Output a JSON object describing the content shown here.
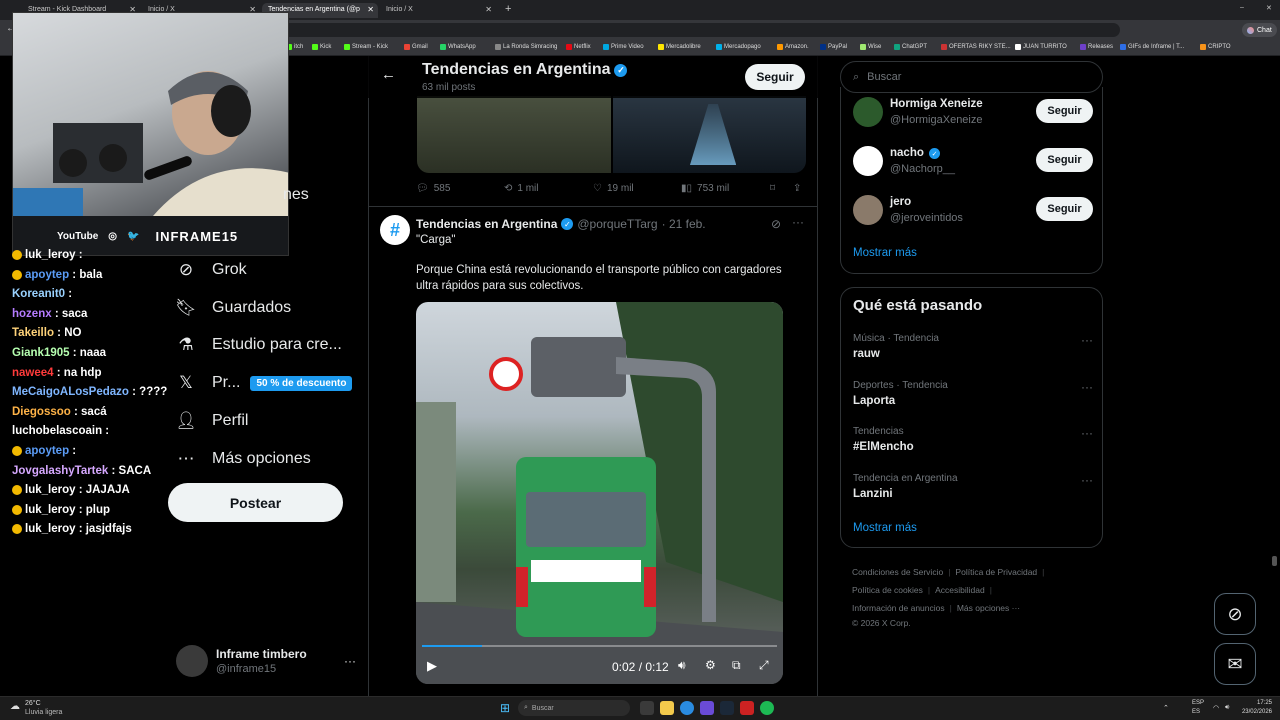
{
  "browser": {
    "tabs": [
      {
        "label": "Stream - Kick Dashboard"
      },
      {
        "label": "Inicio / X"
      },
      {
        "label": "Tendencias en Argentina (@p"
      },
      {
        "label": "Inicio / X"
      }
    ],
    "bookmarks": [
      "itch",
      "Kick",
      "Stream - Kick",
      "Gmail",
      "WhatsApp",
      "La Ronda Simracing",
      "Netflix",
      "Prime Video",
      "Mercadolibre",
      "Mercadopago",
      "Amazon.",
      "PayPal",
      "Wise",
      "ChatGPT",
      "OFERTAS RIKY STE...",
      "JUAN TURRITO",
      "Releases",
      "GIFs de Inframe | T...",
      "CRIPTO"
    ],
    "chat_label": "Chat"
  },
  "overlay": {
    "youtube": "YouTube",
    "handle": "INFRAME15",
    "chat": [
      {
        "user": "luk_leroy",
        "msg": "",
        "color": "#ffffff",
        "badge": true
      },
      {
        "user": "apoytep",
        "msg": "bala",
        "color": "#5b9cf6",
        "badge": true
      },
      {
        "user": "Koreanit0",
        "msg": "",
        "color": "#9ad2ff",
        "badge": false
      },
      {
        "user": "hozenx",
        "msg": "saca",
        "color": "#b57cff",
        "badge": false
      },
      {
        "user": "Takeillo",
        "msg": "NO",
        "color": "#ffd37a",
        "badge": false
      },
      {
        "user": "Giank1905",
        "msg": "naaa",
        "color": "#b6ffb0",
        "badge": false
      },
      {
        "user": "nawee4",
        "msg": "na hdp",
        "color": "#ff3b3b",
        "badge": false
      },
      {
        "user": "MeCaigoALosPedazo",
        "msg": "????",
        "color": "#7fb6ff",
        "badge": false
      },
      {
        "user": "Diegossoo",
        "msg": "sacá",
        "color": "#ffb347",
        "badge": false
      },
      {
        "user": "luchobelascoain",
        "msg": "",
        "color": "#ffffff",
        "badge": false
      },
      {
        "user": "apoytep",
        "msg": "",
        "color": "#5b9cf6",
        "badge": true
      },
      {
        "user": "JovgalashyTartek",
        "msg": "SACA",
        "color": "#d6a8ff",
        "badge": false
      },
      {
        "user": "luk_leroy",
        "msg": "JAJAJA",
        "color": "#ffffff",
        "badge": true
      },
      {
        "user": "luk_leroy",
        "msg": "plup",
        "color": "#ffffff",
        "badge": true
      },
      {
        "user": "luk_leroy",
        "msg": "jasjdfajs",
        "color": "#ffffff",
        "badge": true
      }
    ]
  },
  "nav": {
    "partial_item": "nes",
    "items": [
      {
        "label": "Grok",
        "icon": "grok-icon"
      },
      {
        "label": "Guardados",
        "icon": "bookmark-icon"
      },
      {
        "label": "Estudio para cre...",
        "icon": "studio-icon"
      },
      {
        "label": "Pr...",
        "icon": "x-logo-icon"
      },
      {
        "label": "Perfil",
        "icon": "person-icon"
      },
      {
        "label": "Más opciones",
        "icon": "more-icon"
      }
    ],
    "promo": "50 % de descuento",
    "post": "Postear",
    "account_name": "Inframe timbero",
    "account_handle": "@inframe15"
  },
  "feed": {
    "title": "Tendencias en Argentina",
    "subtitle": "63 mil posts",
    "follow": "Seguir",
    "prev_actions": {
      "replies": "585",
      "reposts": "1 mil",
      "likes": "19 mil",
      "views": "753 mil"
    },
    "post": {
      "author": "Tendencias en Argentina",
      "handle": "@porqueTTarg",
      "date": "· 21 feb.",
      "quote": "\"Carga\"",
      "body": "Porque China está revolucionando el transporte público con cargadores ultra rápidos para sus colectivos.",
      "video_time": "0:02 / 0:12",
      "video_progress": 0.17
    }
  },
  "sidebar": {
    "search_placeholder": "Buscar",
    "who_to_follow": [
      {
        "name": "Hormiga Xeneize",
        "handle": "@HormigaXeneize",
        "button": "Seguir"
      },
      {
        "name": "nacho",
        "handle": "@Nachorp__",
        "button": "Seguir"
      },
      {
        "name": "jero",
        "handle": "@jeroveintidos",
        "button": "Seguir"
      }
    ],
    "show_more": "Mostrar más",
    "happening_title": "Qué está pasando",
    "trends": [
      {
        "meta": "Música · Tendencia",
        "name": "rauw"
      },
      {
        "meta": "Deportes · Tendencia",
        "name": "Laporta"
      },
      {
        "meta": "Tendencias",
        "name": "#ElMencho"
      },
      {
        "meta": "Tendencia en Argentina",
        "name": "Lanzini"
      }
    ],
    "show_more_2": "Mostrar más",
    "footer": [
      "Condiciones de Servicio",
      "Política de Privacidad",
      "Política de cookies",
      "Accesibilidad",
      "Información de anuncios",
      "Más opciones ···",
      "© 2026 X Corp."
    ]
  },
  "taskbar": {
    "weather_temp": "26°C",
    "weather_desc": "Lluvia ligera",
    "search": "Buscar",
    "lang1": "ESP",
    "lang2": "ES",
    "time": "17:25",
    "date": "23/02/2026"
  }
}
